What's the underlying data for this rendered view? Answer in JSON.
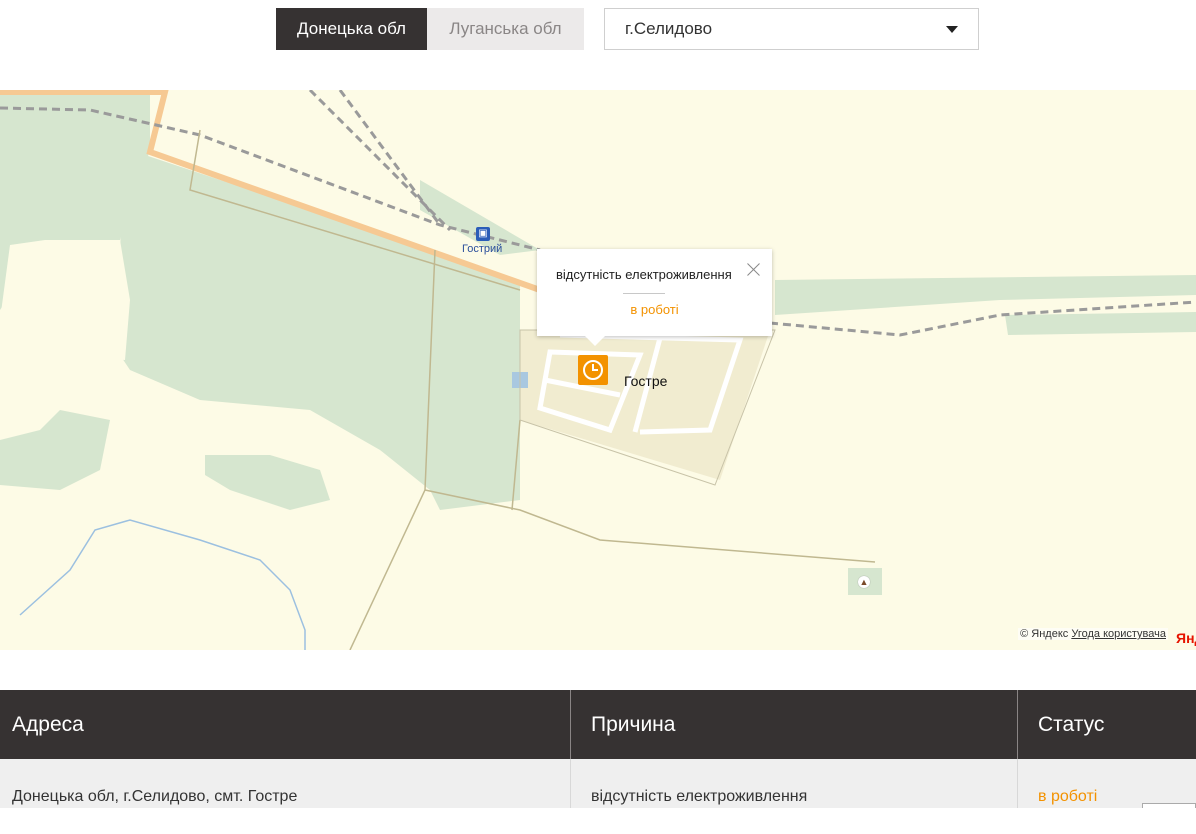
{
  "tabs": [
    {
      "label": "Донецька обл",
      "active": true
    },
    {
      "label": "Луганська обл",
      "active": false
    }
  ],
  "city_select": {
    "value": "г.Селидово"
  },
  "map": {
    "place_label": "Гостре",
    "station_label": "Гострий",
    "balloon": {
      "reason": "відсутність електроживлення",
      "status": "в роботі"
    },
    "copyright": "© Яндекс",
    "terms_link": "Угода користувача",
    "logo": "Яндекс",
    "marker_icon": "clock-icon",
    "colors": {
      "marker": "#f39200",
      "status": "#f39200"
    }
  },
  "table": {
    "headers": {
      "address": "Адреса",
      "reason": "Причина",
      "status": "Статус"
    },
    "rows": [
      {
        "address": "Донецька обл, г.Селидово, смт. Гостре",
        "reason": "відсутність електроживлення",
        "status": "в роботі"
      }
    ]
  }
}
